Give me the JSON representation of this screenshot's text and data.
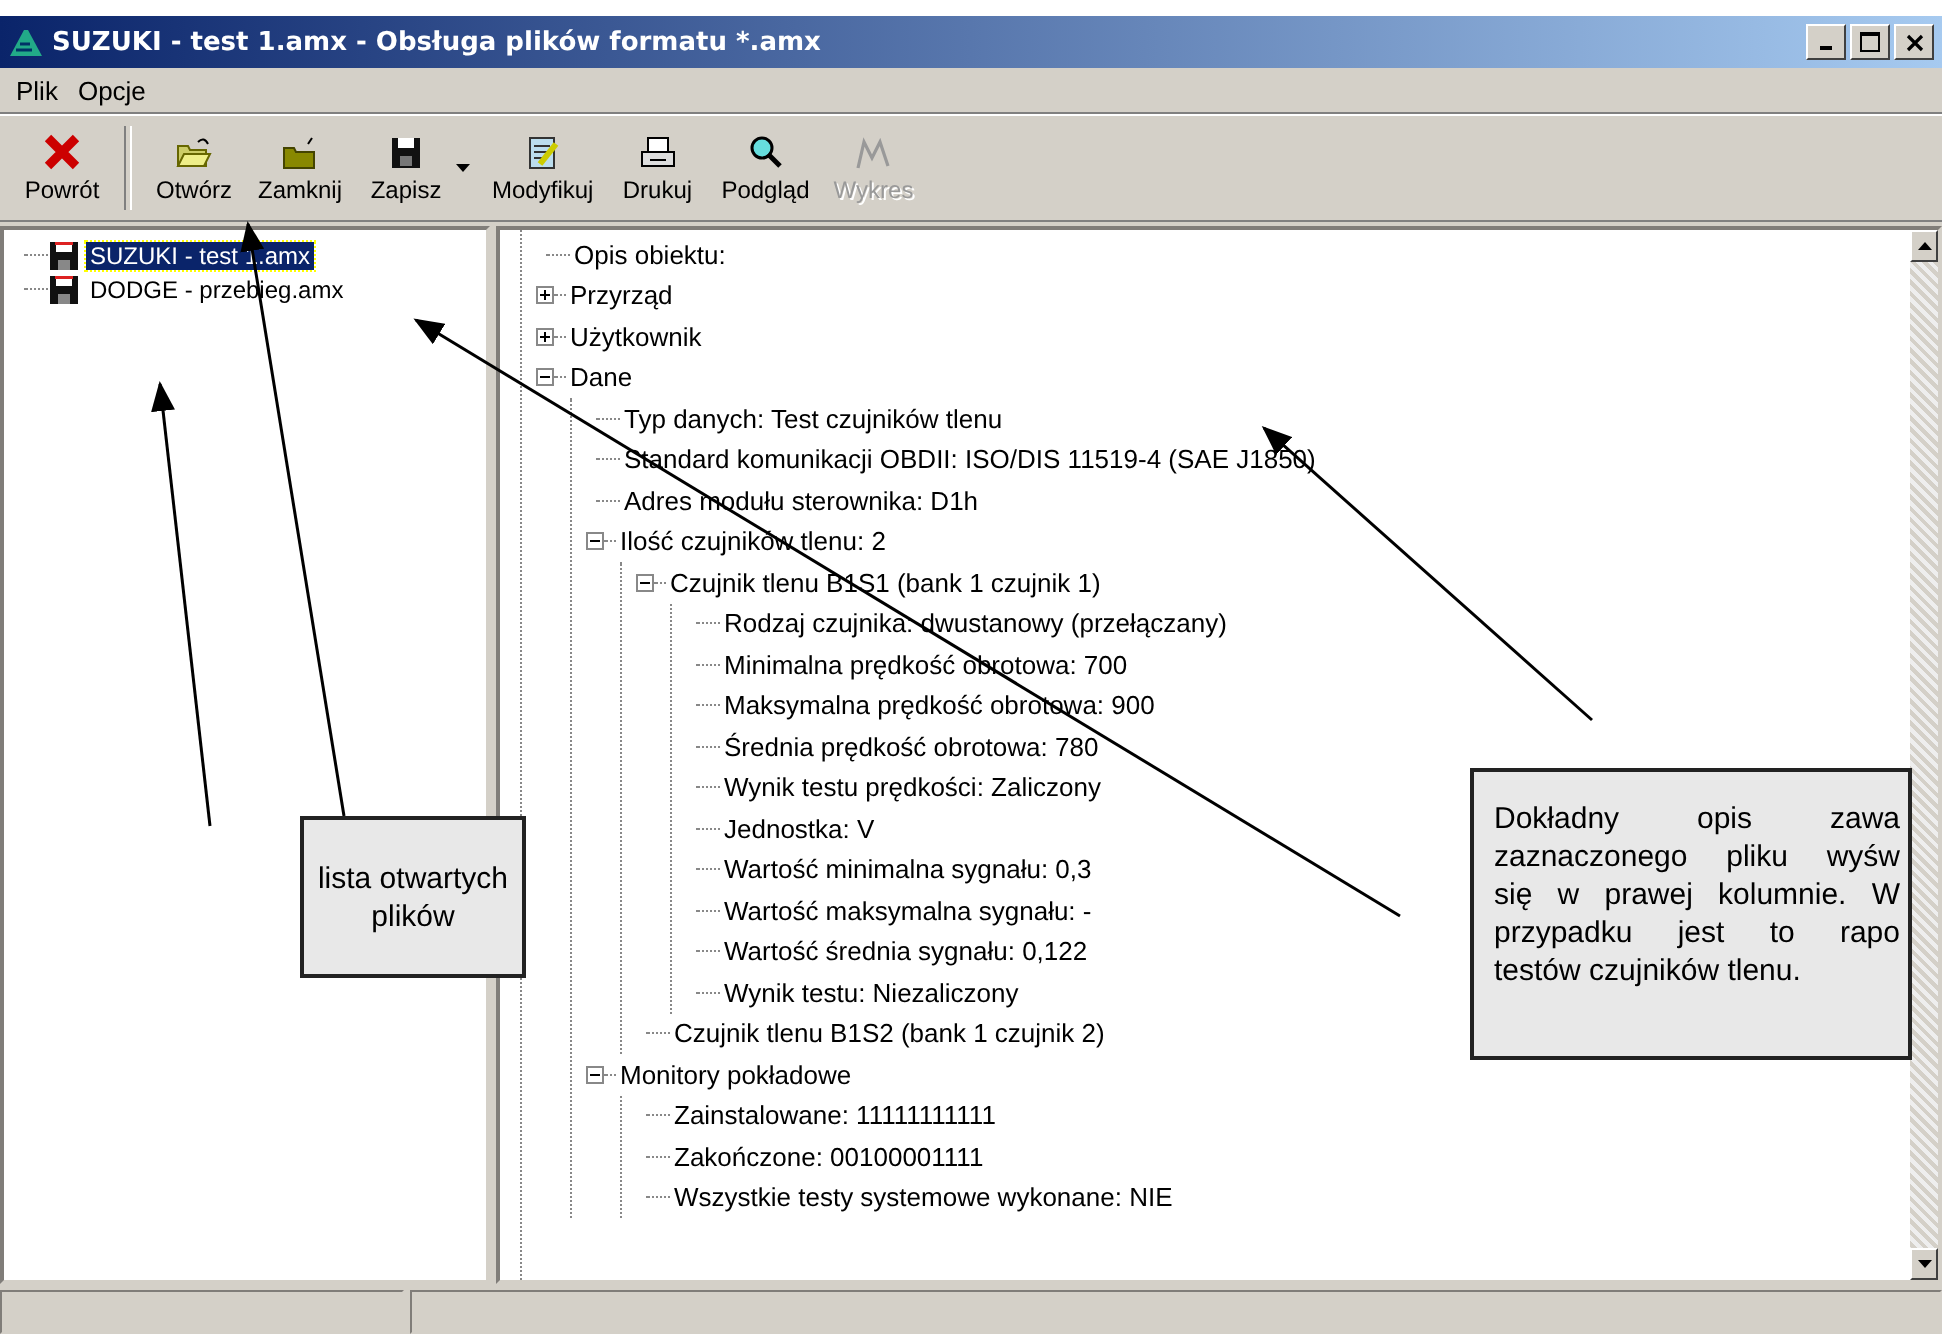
{
  "window": {
    "title": "SUZUKI - test 1.amx - Obsługa plików formatu *.amx"
  },
  "menu": [
    "Plik",
    "Opcje"
  ],
  "toolbar": [
    {
      "label": "Powrót",
      "kind": "back",
      "disabled": false
    },
    {
      "label": "Otwórz",
      "kind": "open",
      "disabled": false
    },
    {
      "label": "Zamknij",
      "kind": "close",
      "disabled": false
    },
    {
      "label": "Zapisz",
      "kind": "save",
      "disabled": false
    },
    {
      "label": "Modyfikuj",
      "kind": "edit",
      "disabled": false
    },
    {
      "label": "Drukuj",
      "kind": "print",
      "disabled": false
    },
    {
      "label": "Podgląd",
      "kind": "preview",
      "disabled": false
    },
    {
      "label": "Wykres",
      "kind": "chart",
      "disabled": true
    }
  ],
  "files": [
    {
      "name": "SUZUKI - test 1.amx",
      "selected": true
    },
    {
      "name": "DODGE - przebieg.amx",
      "selected": false
    }
  ],
  "tree": [
    {
      "label": "Opis obiektu:"
    },
    {
      "label": "Przyrząd",
      "expanded": false
    },
    {
      "label": "Użytkownik",
      "expanded": false
    },
    {
      "label": "Dane",
      "expanded": true,
      "children": [
        {
          "label": "Typ danych: Test czujników tlenu"
        },
        {
          "label": "Standard komunikacji OBDII: ISO/DIS 11519-4 (SAE J1850)"
        },
        {
          "label": "Adres modułu sterownika: D1h"
        },
        {
          "label": "Ilość czujników tlenu: 2",
          "expanded": true,
          "children": [
            {
              "label": "Czujnik tlenu B1S1 (bank 1 czujnik 1)",
              "expanded": true,
              "children": [
                {
                  "label": "Rodzaj czujnika: dwustanowy (przełączany)"
                },
                {
                  "label": "Minimalna prędkość obrotowa: 700"
                },
                {
                  "label": "Maksymalna prędkość obrotowa: 900"
                },
                {
                  "label": "Średnia prędkość obrotowa: 780"
                },
                {
                  "label": "Wynik testu prędkości: Zaliczony"
                },
                {
                  "label": "Jednostka: V"
                },
                {
                  "label": "Wartość minimalna sygnału: 0,3"
                },
                {
                  "label": "Wartość maksymalna sygnału: -"
                },
                {
                  "label": "Wartość średnia sygnału: 0,122"
                },
                {
                  "label": "Wynik testu: Niezaliczony"
                }
              ]
            },
            {
              "label": "Czujnik tlenu B1S2 (bank 1 czujnik 2)"
            }
          ]
        },
        {
          "label": "Monitory pokładowe",
          "expanded": true,
          "children": [
            {
              "label": "Zainstalowane: 11111111111"
            },
            {
              "label": "Zakończone: 00100001111"
            },
            {
              "label": "Wszystkie testy systemowe wykonane: NIE"
            }
          ]
        }
      ]
    }
  ],
  "callouts": [
    {
      "lines": [
        "lista otwartych",
        "plików"
      ]
    },
    {
      "lines": [
        "Dokładny opis zawa",
        "zaznaczonego pliku wyśw",
        "się w prawej kolumnie. W",
        "przypadku jest to rapo",
        "testów czujników tlenu."
      ]
    }
  ]
}
